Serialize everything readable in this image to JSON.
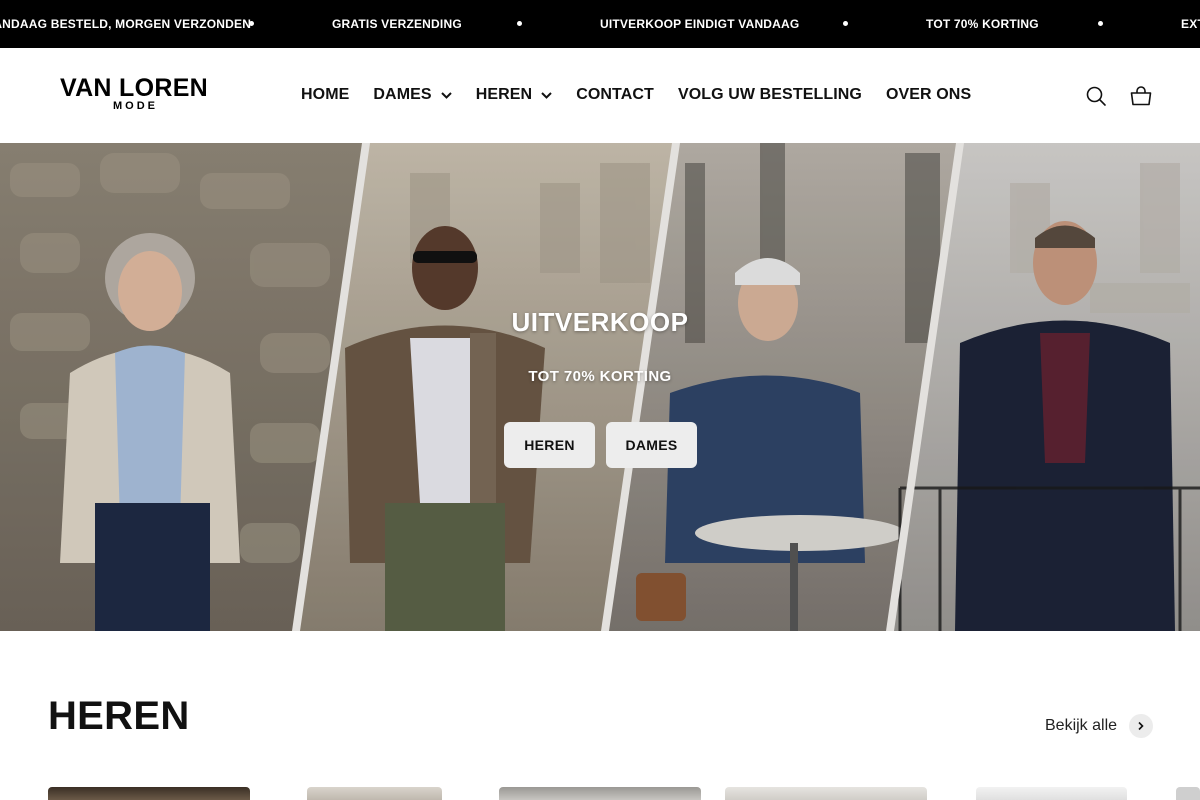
{
  "announcement": {
    "messages": [
      "VANDAAG BESTELD, MORGEN VERZONDEN",
      "GRATIS VERZENDING",
      "UITVERKOOP EINDIGT VANDAAG",
      "TOT 70% KORTING",
      "EXTRA KORTING"
    ]
  },
  "header": {
    "logo_line1": "VAN LOREN",
    "logo_line2": "MODE",
    "nav": [
      {
        "label": "HOME"
      },
      {
        "label": "DAMES"
      },
      {
        "label": "HEREN"
      },
      {
        "label": "CONTACT"
      },
      {
        "label": "VOLG UW BESTELLING"
      },
      {
        "label": "OVER ONS"
      }
    ],
    "icons": [
      "search-icon",
      "cart-icon"
    ]
  },
  "hero": {
    "title": "UITVERKOOP",
    "subtitle": "TOT 70% KORTING",
    "buttons": [
      {
        "label": "HEREN"
      },
      {
        "label": "DAMES"
      }
    ]
  },
  "section": {
    "title": "HEREN",
    "view_all": "Bekijk alle"
  },
  "colors": {
    "announcement_bg": "#000000",
    "button_bg": "#ededed",
    "text": "#111111"
  }
}
